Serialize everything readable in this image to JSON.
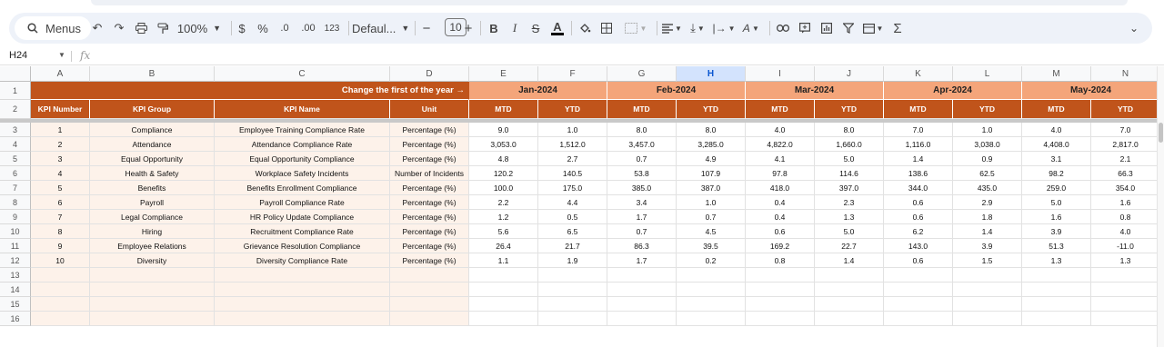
{
  "toolbar": {
    "menus_label": "Menus",
    "zoom": "100%",
    "currency": "$",
    "percent": "%",
    "dec_decrease": ".0",
    "dec_increase": ".00",
    "number_format": "123",
    "font": "Defaul...",
    "font_size": "10",
    "minus": "−",
    "plus": "+",
    "bold": "B",
    "italic": "I",
    "strike": "S",
    "text_color": "A",
    "sum": "Σ"
  },
  "formula_bar": {
    "name_box": "H24",
    "fx": "fx"
  },
  "columns": [
    "A",
    "B",
    "C",
    "D",
    "E",
    "F",
    "G",
    "H",
    "I",
    "J",
    "K",
    "L",
    "M",
    "N"
  ],
  "selected_column": "H",
  "rows": [
    "1",
    "2",
    "3",
    "4",
    "5",
    "6",
    "7",
    "8",
    "9",
    "10",
    "11",
    "12",
    "13",
    "14",
    "15",
    "16"
  ],
  "header_row1": {
    "label": "Change the first of the year →",
    "months": [
      "Jan-2024",
      "Feb-2024",
      "Mar-2024",
      "Apr-2024",
      "May-2024"
    ]
  },
  "header_row2": [
    "KPI Number",
    "KPI Group",
    "KPI Name",
    "Unit",
    "MTD",
    "YTD",
    "MTD",
    "YTD",
    "MTD",
    "YTD",
    "MTD",
    "YTD",
    "MTD",
    "YTD"
  ],
  "data_rows": [
    [
      "1",
      "Compliance",
      "Employee Training Compliance Rate",
      "Percentage (%)",
      "9.0",
      "1.0",
      "8.0",
      "8.0",
      "4.0",
      "8.0",
      "7.0",
      "1.0",
      "4.0",
      "7.0"
    ],
    [
      "2",
      "Attendance",
      "Attendance Compliance Rate",
      "Percentage (%)",
      "3,053.0",
      "1,512.0",
      "3,457.0",
      "3,285.0",
      "4,822.0",
      "1,660.0",
      "1,116.0",
      "3,038.0",
      "4,408.0",
      "2,817.0"
    ],
    [
      "3",
      "Equal Opportunity",
      "Equal Opportunity Compliance",
      "Percentage (%)",
      "4.8",
      "2.7",
      "0.7",
      "4.9",
      "4.1",
      "5.0",
      "1.4",
      "0.9",
      "3.1",
      "2.1"
    ],
    [
      "4",
      "Health & Safety",
      "Workplace Safety Incidents",
      "Number of Incidents",
      "120.2",
      "140.5",
      "53.8",
      "107.9",
      "97.8",
      "114.6",
      "138.6",
      "62.5",
      "98.2",
      "66.3"
    ],
    [
      "5",
      "Benefits",
      "Benefits Enrollment Compliance",
      "Percentage (%)",
      "100.0",
      "175.0",
      "385.0",
      "387.0",
      "418.0",
      "397.0",
      "344.0",
      "435.0",
      "259.0",
      "354.0"
    ],
    [
      "6",
      "Payroll",
      "Payroll Compliance Rate",
      "Percentage (%)",
      "2.2",
      "4.4",
      "3.4",
      "1.0",
      "0.4",
      "2.3",
      "0.6",
      "2.9",
      "5.0",
      "1.6"
    ],
    [
      "7",
      "Legal Compliance",
      "HR Policy Update Compliance",
      "Percentage (%)",
      "1.2",
      "0.5",
      "1.7",
      "0.7",
      "0.4",
      "1.3",
      "0.6",
      "1.8",
      "1.6",
      "0.8"
    ],
    [
      "8",
      "Hiring",
      "Recruitment Compliance Rate",
      "Percentage (%)",
      "5.6",
      "6.5",
      "0.7",
      "4.5",
      "0.6",
      "5.0",
      "6.2",
      "1.4",
      "3.9",
      "4.0"
    ],
    [
      "9",
      "Employee Relations",
      "Grievance Resolution Compliance",
      "Percentage (%)",
      "26.4",
      "21.7",
      "86.3",
      "39.5",
      "169.2",
      "22.7",
      "143.0",
      "3.9",
      "51.3",
      "-11.0"
    ],
    [
      "10",
      "Diversity",
      "Diversity Compliance Rate",
      "Percentage (%)",
      "1.1",
      "1.9",
      "1.7",
      "0.2",
      "0.8",
      "1.4",
      "0.6",
      "1.5",
      "1.3",
      "1.3"
    ]
  ],
  "colors": {
    "header_dark": "#c0541b",
    "header_light": "#f4a57a",
    "left_fill": "#fdf2ea"
  }
}
